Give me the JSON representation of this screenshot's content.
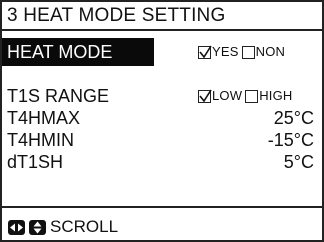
{
  "screen": {
    "title": "3 HEAT MODE SETTING"
  },
  "rows": [
    {
      "label": "HEAT MODE",
      "selected": true,
      "options": [
        {
          "label": "YES",
          "checked": true
        },
        {
          "label": "NON",
          "checked": false
        }
      ]
    },
    {
      "label": "T1S RANGE",
      "selected": false,
      "options": [
        {
          "label": "LOW",
          "checked": true
        },
        {
          "label": "HIGH",
          "checked": false
        }
      ]
    },
    {
      "label": "T4HMAX",
      "value": "25°C"
    },
    {
      "label": "T4HMIN",
      "value": "-15°C"
    },
    {
      "label": "dT1SH",
      "value": "5°C"
    }
  ],
  "footer": {
    "icons": [
      "left-right-arrow-key-icon",
      "up-down-arrow-key-icon"
    ],
    "label": "SCROLL"
  },
  "colors": {
    "text": "#111111",
    "highlight_bg": "#0a0a0a",
    "highlight_text": "#ffffff",
    "border": "#222222"
  }
}
